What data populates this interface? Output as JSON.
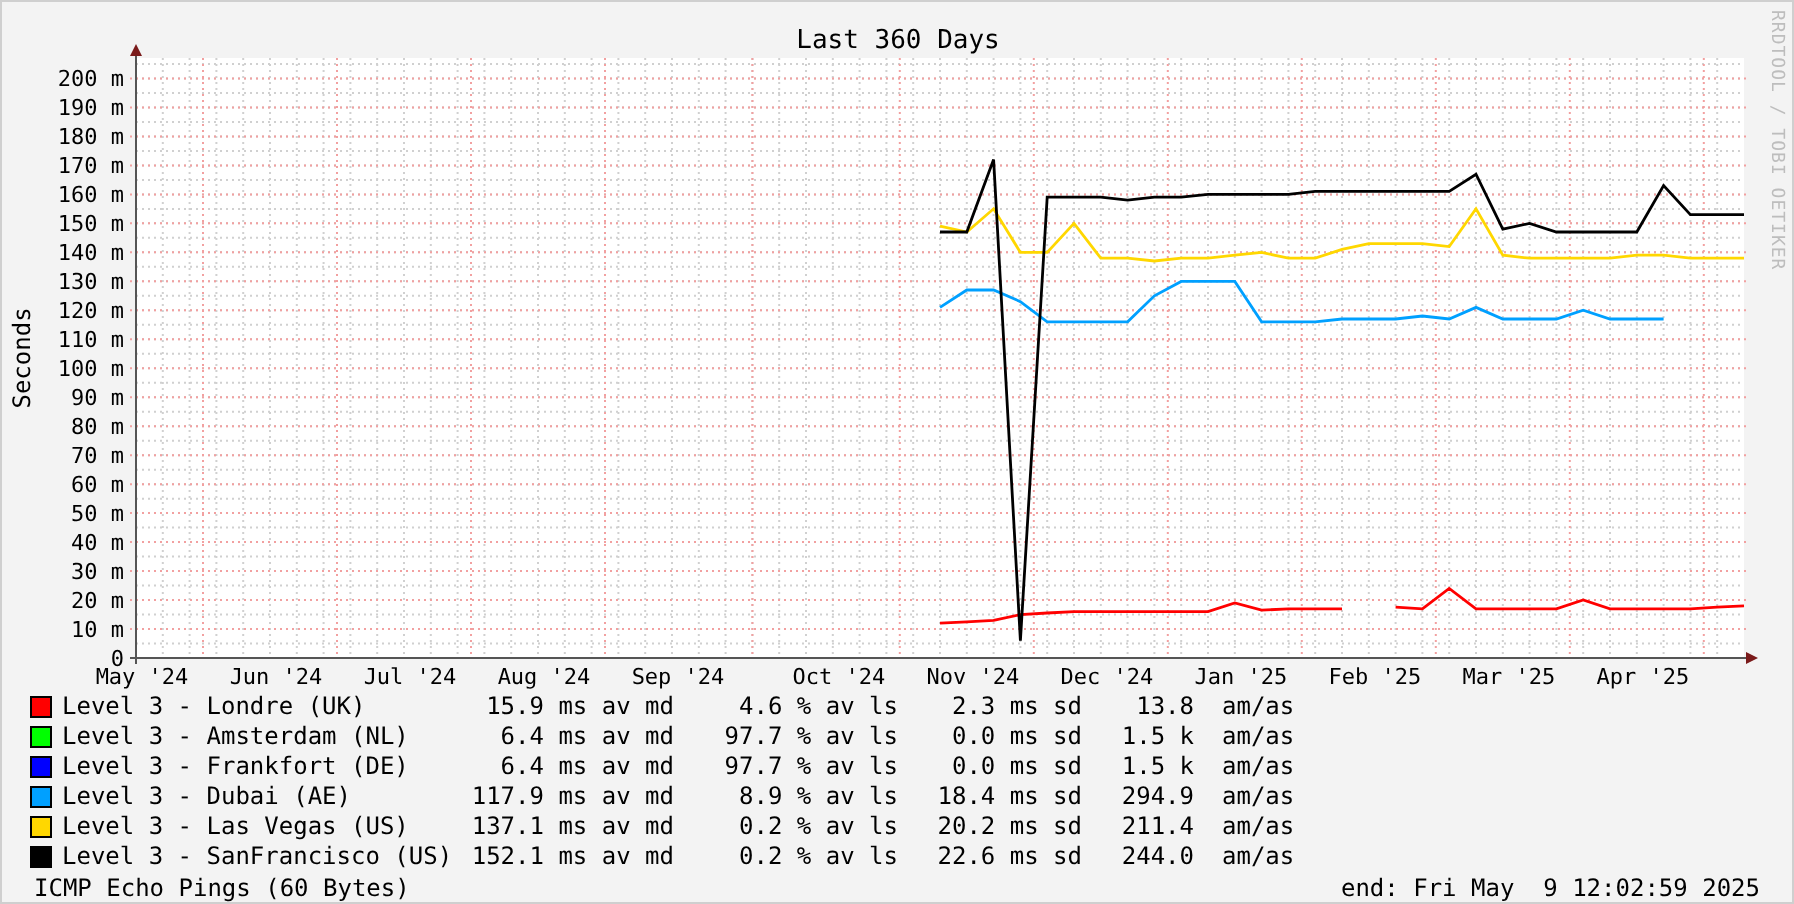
{
  "watermark_side": "RRDTOOL / TOBI OETIKER",
  "chart": {
    "chart_data": {
      "type": "line",
      "title": "Last 360 Days",
      "ylabel": "Seconds",
      "grid": true,
      "ylim": [
        0,
        205
      ],
      "categories": [
        "May '24",
        null,
        null,
        null,
        null,
        "Jun '24",
        null,
        null,
        null,
        null,
        "Jul '24",
        null,
        null,
        null,
        null,
        "Aug '24",
        null,
        null,
        null,
        null,
        "Sep '24",
        null,
        null,
        null,
        null,
        null,
        "Oct '24",
        null,
        null,
        null,
        null,
        "Nov '24",
        null,
        null,
        null,
        null,
        "Dec '24",
        null,
        null,
        null,
        null,
        "Jan '25",
        null,
        null,
        null,
        null,
        "Feb '25",
        null,
        null,
        null,
        null,
        "Mar '25",
        null,
        null,
        null,
        null,
        "Apr '25",
        null,
        null,
        null,
        null
      ],
      "yticks": [
        {
          "value": 0,
          "label": "0"
        },
        {
          "value": 10,
          "label": "10 m"
        },
        {
          "value": 20,
          "label": "20 m"
        },
        {
          "value": 30,
          "label": "30 m"
        },
        {
          "value": 40,
          "label": "40 m"
        },
        {
          "value": 50,
          "label": "50 m"
        },
        {
          "value": 60,
          "label": "60 m"
        },
        {
          "value": 70,
          "label": "70 m"
        },
        {
          "value": 80,
          "label": "80 m"
        },
        {
          "value": 90,
          "label": "90 m"
        },
        {
          "value": 100,
          "label": "100 m"
        },
        {
          "value": 110,
          "label": "110 m"
        },
        {
          "value": 120,
          "label": "120 m"
        },
        {
          "value": 130,
          "label": "130 m"
        },
        {
          "value": 140,
          "label": "140 m"
        },
        {
          "value": 150,
          "label": "150 m"
        },
        {
          "value": 160,
          "label": "160 m"
        },
        {
          "value": 170,
          "label": "170 m"
        },
        {
          "value": 180,
          "label": "180 m"
        },
        {
          "value": 190,
          "label": "190 m"
        },
        {
          "value": 200,
          "label": "200 m"
        }
      ],
      "series": [
        {
          "name": "Level 3 - Londre (UK)",
          "color": "#ff0000",
          "values": [
            null,
            null,
            null,
            null,
            null,
            null,
            null,
            null,
            null,
            null,
            null,
            null,
            null,
            null,
            null,
            null,
            null,
            null,
            null,
            null,
            null,
            null,
            null,
            null,
            null,
            null,
            null,
            null,
            null,
            null,
            12,
            12.5,
            13,
            15,
            15.5,
            16,
            16,
            16,
            16,
            16,
            16,
            19,
            16.5,
            17,
            17,
            17,
            null,
            17.5,
            17,
            24,
            17,
            17,
            17,
            17,
            20,
            17,
            17,
            17,
            17,
            17.5,
            18
          ]
        },
        {
          "name": "Level 3 - Amsterdam (NL)",
          "color": "#00ff00",
          "values": [
            null,
            null,
            null,
            null,
            null,
            null,
            null,
            null,
            null,
            null,
            null,
            null,
            null,
            null,
            null,
            null,
            null,
            null,
            null,
            null,
            null,
            null,
            null,
            null,
            null,
            null,
            null,
            null,
            null,
            null,
            null,
            null,
            null,
            null,
            null,
            null,
            null,
            null,
            null,
            null,
            null,
            null,
            null,
            null,
            null,
            null,
            null,
            null,
            null,
            null,
            null,
            null,
            null,
            null,
            null,
            null,
            null,
            null,
            null,
            null,
            null
          ]
        },
        {
          "name": "Level 3 - Frankfort (DE)",
          "color": "#0000ff",
          "values": [
            null,
            null,
            null,
            null,
            null,
            null,
            null,
            null,
            null,
            null,
            null,
            null,
            null,
            null,
            null,
            null,
            null,
            null,
            null,
            null,
            null,
            null,
            null,
            null,
            null,
            null,
            null,
            null,
            null,
            null,
            null,
            null,
            null,
            null,
            null,
            null,
            null,
            null,
            null,
            null,
            null,
            null,
            null,
            null,
            null,
            null,
            null,
            null,
            null,
            null,
            null,
            null,
            null,
            null,
            null,
            null,
            null,
            null,
            null,
            null,
            null
          ]
        },
        {
          "name": "Level 3 - Dubai (AE)",
          "color": "#00a0ff",
          "values": [
            null,
            null,
            null,
            null,
            null,
            null,
            null,
            null,
            null,
            null,
            null,
            null,
            null,
            null,
            null,
            null,
            null,
            null,
            null,
            null,
            null,
            null,
            null,
            null,
            null,
            null,
            null,
            null,
            null,
            null,
            121,
            127,
            127,
            123,
            116,
            116,
            116,
            116,
            125,
            130,
            130,
            130,
            116,
            116,
            116,
            117,
            117,
            117,
            118,
            117,
            121,
            117,
            117,
            117,
            120,
            117,
            117,
            117,
            null,
            null,
            null
          ]
        },
        {
          "name": "Level 3 - Las Vegas (US)",
          "color": "#ffd700",
          "values": [
            null,
            null,
            null,
            null,
            null,
            null,
            null,
            null,
            null,
            null,
            null,
            null,
            null,
            null,
            null,
            null,
            null,
            null,
            null,
            null,
            null,
            null,
            null,
            null,
            null,
            null,
            null,
            null,
            null,
            null,
            149,
            147,
            155,
            140,
            140,
            150,
            138,
            138,
            137,
            138,
            138,
            139,
            140,
            138,
            138,
            141,
            143,
            143,
            143,
            142,
            155,
            139,
            138,
            138,
            138,
            138,
            139,
            139,
            138,
            138,
            138
          ]
        },
        {
          "name": "Level 3 - SanFrancisco (US)",
          "color": "#000000",
          "values": [
            null,
            null,
            null,
            null,
            null,
            null,
            null,
            null,
            null,
            null,
            null,
            null,
            null,
            null,
            null,
            null,
            null,
            null,
            null,
            null,
            null,
            null,
            null,
            null,
            null,
            null,
            null,
            null,
            null,
            null,
            147,
            147,
            172,
            6,
            159,
            159,
            159,
            158,
            159,
            159,
            160,
            160,
            160,
            160,
            161,
            161,
            161,
            161,
            161,
            161,
            167,
            148,
            150,
            147,
            147,
            147,
            147,
            163,
            153,
            153,
            153
          ]
        }
      ]
    }
  },
  "legend": [
    {
      "median": "15.9 ms av md",
      "loss": "4.6 % av ls",
      "sd": "2.3 ms sd",
      "ratio": "13.8",
      "unit": "am/as"
    },
    {
      "median": "6.4 ms av md",
      "loss": "97.7 % av ls",
      "sd": "0.0 ms sd",
      "ratio": "1.5 k",
      "unit": "am/as"
    },
    {
      "median": "6.4 ms av md",
      "loss": "97.7 % av ls",
      "sd": "0.0 ms sd",
      "ratio": "1.5 k",
      "unit": "am/as"
    },
    {
      "median": "117.9 ms av md",
      "loss": "8.9 % av ls",
      "sd": "18.4 ms sd",
      "ratio": "294.9",
      "unit": "am/as"
    },
    {
      "median": "137.1 ms av md",
      "loss": "0.2 % av ls",
      "sd": "20.2 ms sd",
      "ratio": "211.4",
      "unit": "am/as"
    },
    {
      "median": "152.1 ms av md",
      "loss": "0.2 % av ls",
      "sd": "22.6 ms sd",
      "ratio": "244.0",
      "unit": "am/as"
    }
  ],
  "footer": {
    "probe": "ICMP Echo Pings (60 Bytes)",
    "end": "end: Fri May  9 12:02:59 2025"
  }
}
